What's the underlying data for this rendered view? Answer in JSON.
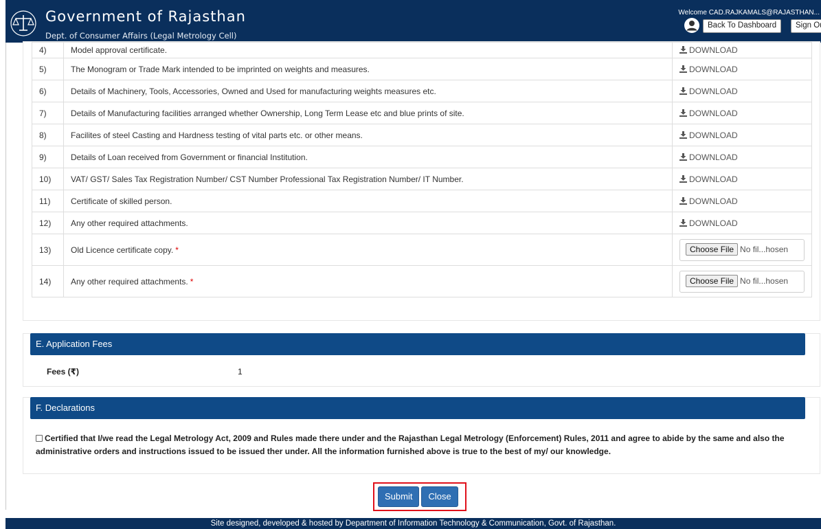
{
  "header": {
    "title": "Government of Rajasthan",
    "subtitle": "Dept. of Consumer Affairs (Legal Metrology Cell)",
    "welcome": "Welcome CAD.RAJKAMALS@RAJASTHAN...",
    "back_to_dashboard": "Back To Dashboard",
    "sign_out": "Sign Out",
    "emblem_icon": "scales-emblem-icon",
    "avatar_icon": "user-avatar-icon"
  },
  "documents": {
    "download_label": "DOWNLOAD",
    "download_icon": "download-icon",
    "required_marker": "*",
    "rows": [
      {
        "num": "4)",
        "label": "Model approval certificate."
      },
      {
        "num": "5)",
        "label": "The Monogram or Trade Mark intended to be imprinted on weights and measures."
      },
      {
        "num": "6)",
        "label": "Details of Machinery, Tools, Accessories, Owned and Used for manufacturing weights measures etc."
      },
      {
        "num": "7)",
        "label": "Details of Manufacturing facilities arranged whether Ownership, Long Term Lease etc and blue prints of site."
      },
      {
        "num": "8)",
        "label": "Facilites of steel Casting and Hardness testing of vital parts etc. or other means."
      },
      {
        "num": "9)",
        "label": "Details of Loan received from Government or financial Institution."
      },
      {
        "num": "10)",
        "label": "VAT/ GST/ Sales Tax Registration Number/ CST Number Professional Tax Registration Number/ IT Number."
      },
      {
        "num": "11)",
        "label": "Certificate of skilled person."
      },
      {
        "num": "12)",
        "label": "Any other required attachments."
      }
    ],
    "upload_rows": [
      {
        "num": "13)",
        "label": "Old Licence certificate copy.",
        "button": "Choose File",
        "status": "No fil...hosen"
      },
      {
        "num": "14)",
        "label": "Any other required attachments.",
        "button": "Choose File",
        "status": "No fil...hosen"
      }
    ]
  },
  "fees": {
    "heading": "E. Application Fees",
    "label": "Fees (₹)",
    "value": "1"
  },
  "declarations": {
    "heading": "F. Declarations",
    "text": "Certified that I/we read the Legal Metrology Act, 2009 and Rules made there under and the Rajasthan Legal Metrology (Enforcement) Rules, 2011 and agree to abide by the same and also the administrative orders and instructions issued to be issued ther under. All the information furnished above is true to the best of my/ our knowledge."
  },
  "actions": {
    "submit": "Submit",
    "close": "Close"
  },
  "footer": {
    "text": "Site designed, developed & hosted by Department of Information Technology & Communication, Govt. of Rajasthan."
  }
}
